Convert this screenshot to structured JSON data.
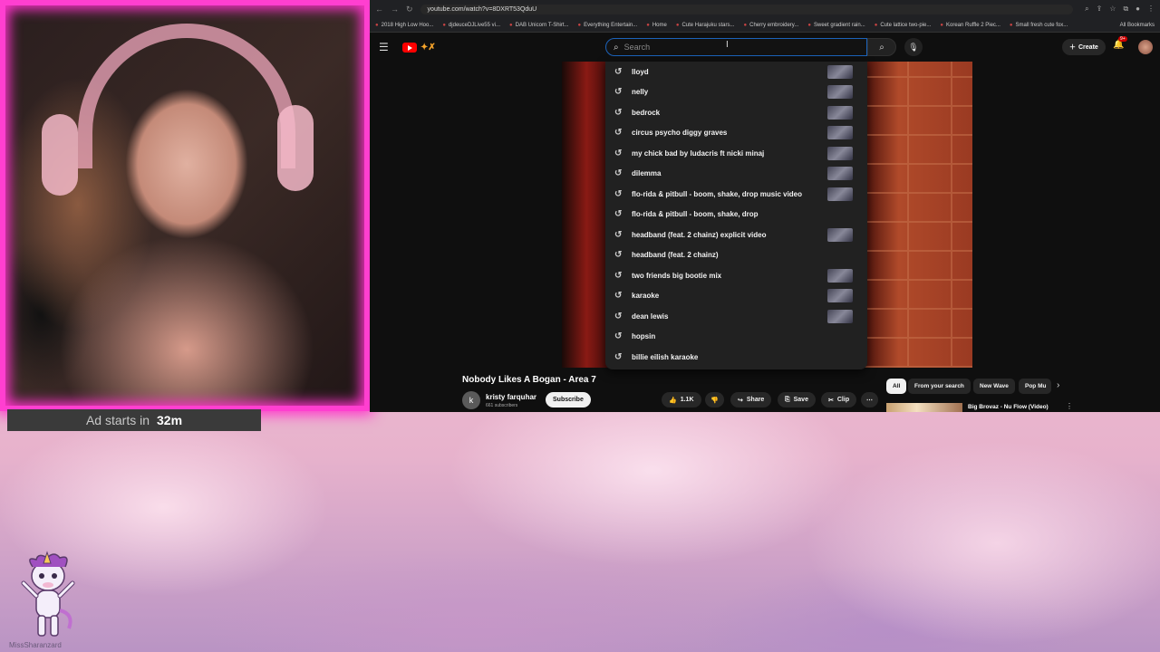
{
  "ad": {
    "label": "Ad starts in",
    "time": "32m"
  },
  "browser": {
    "url": "youtube.com/watch?v=8DXRT53QduU",
    "bookmarks": [
      "2018 High Low Hoo...",
      "djdeuceDJLive55 vi...",
      "DAB Unicorn T-Shirt...",
      "Everything Entertain...",
      "Home",
      "Cute Harajuku stars...",
      "Cherry embroidery...",
      "Sweet gradient rain...",
      "Cute lattice two-pie...",
      "Korean Ruffle 2 Piec...",
      "Small fresh cute fox..."
    ],
    "all_bookmarks": "All Bookmarks"
  },
  "youtube": {
    "search_placeholder": "Search",
    "create_label": "Create",
    "notif_badge": "9+",
    "suggestions": [
      {
        "text": "lloyd",
        "thumb": true
      },
      {
        "text": "nelly",
        "thumb": true
      },
      {
        "text": "bedrock",
        "thumb": true
      },
      {
        "text": "circus psycho diggy graves",
        "thumb": true
      },
      {
        "text": "my chick bad by ludacris ft nicki minaj",
        "thumb": true
      },
      {
        "text": "dilemma",
        "thumb": true
      },
      {
        "text": "flo-rida & pitbull - boom, shake, drop music video",
        "thumb": true
      },
      {
        "text": "flo-rida & pitbull - boom, shake, drop",
        "thumb": false
      },
      {
        "text": "headband (feat. 2 chainz) explicit video",
        "thumb": true
      },
      {
        "text": "headband (feat. 2 chainz)",
        "thumb": false
      },
      {
        "text": "two friends big bootie mix",
        "thumb": true
      },
      {
        "text": "karaoke",
        "thumb": true
      },
      {
        "text": "dean lewis",
        "thumb": true
      },
      {
        "text": "hopsin",
        "thumb": false
      },
      {
        "text": "billie eilish karaoke",
        "thumb": false
      }
    ],
    "video_title": "Nobody Likes A Bogan - Area 7",
    "channel_initial": "k",
    "channel_name": "kristy farquhar",
    "channel_subs": "661 subscribers",
    "subscribe_label": "Subscribe",
    "likes": "1.1K",
    "share_label": "Share",
    "save_label": "Save",
    "clip_label": "Clip",
    "chips": [
      "All",
      "From your search",
      "New Wave",
      "Pop Mu"
    ],
    "rec_title": "Big Brovaz - Nu Flow (Video)"
  },
  "mascot_name": "MissSharanzard",
  "colors": {
    "frame": "#ff3fd0",
    "yt_red": "#ff0000",
    "focus_blue": "#1c62b9"
  }
}
